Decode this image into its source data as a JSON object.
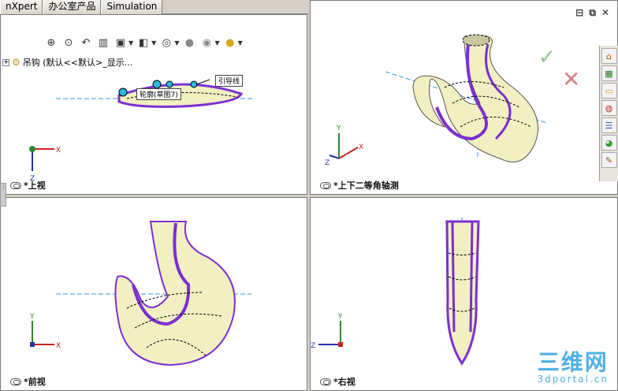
{
  "tabs": [
    "nXpert",
    "办公室产品",
    "Simulation"
  ],
  "tree": {
    "expand": "+",
    "part_label": "吊钩 (默认<<默认>_显示..."
  },
  "callouts": {
    "guide_line": "引导线",
    "profile": "轮廓(草图7)"
  },
  "views": {
    "top": "*上视",
    "iso": "*上下二等角轴测",
    "front": "*前视",
    "right": "*右视"
  },
  "axes": {
    "x": "X",
    "y": "Y",
    "z": "Z"
  },
  "window_controls": [
    "⊟",
    "⧉",
    "✕"
  ],
  "confirm_symbol": "✓",
  "cancel_symbol": "✕",
  "hud_icons": [
    "zoom-fit-icon",
    "zoom-area-icon",
    "previous-view-icon",
    "section-view-icon",
    "view-orientation-icon",
    "display-style-icon",
    "hide-show-icon",
    "edit-appearance-icon",
    "apply-scene-icon"
  ],
  "task_icons": [
    "home-icon",
    "resources-icon",
    "folder-icon",
    "design-library-icon",
    "properties-icon",
    "appearance-icon",
    "custom-props-icon"
  ],
  "watermark": {
    "big": "三维网",
    "small": "3dportal.cn"
  },
  "colors": {
    "sweep": "#7d2fd0",
    "surface": "#f2f0c2",
    "dim": "#3a96e0",
    "axis_x": "#cc2222",
    "axis_y": "#2a8a2a",
    "axis_z": "#2233aa"
  }
}
